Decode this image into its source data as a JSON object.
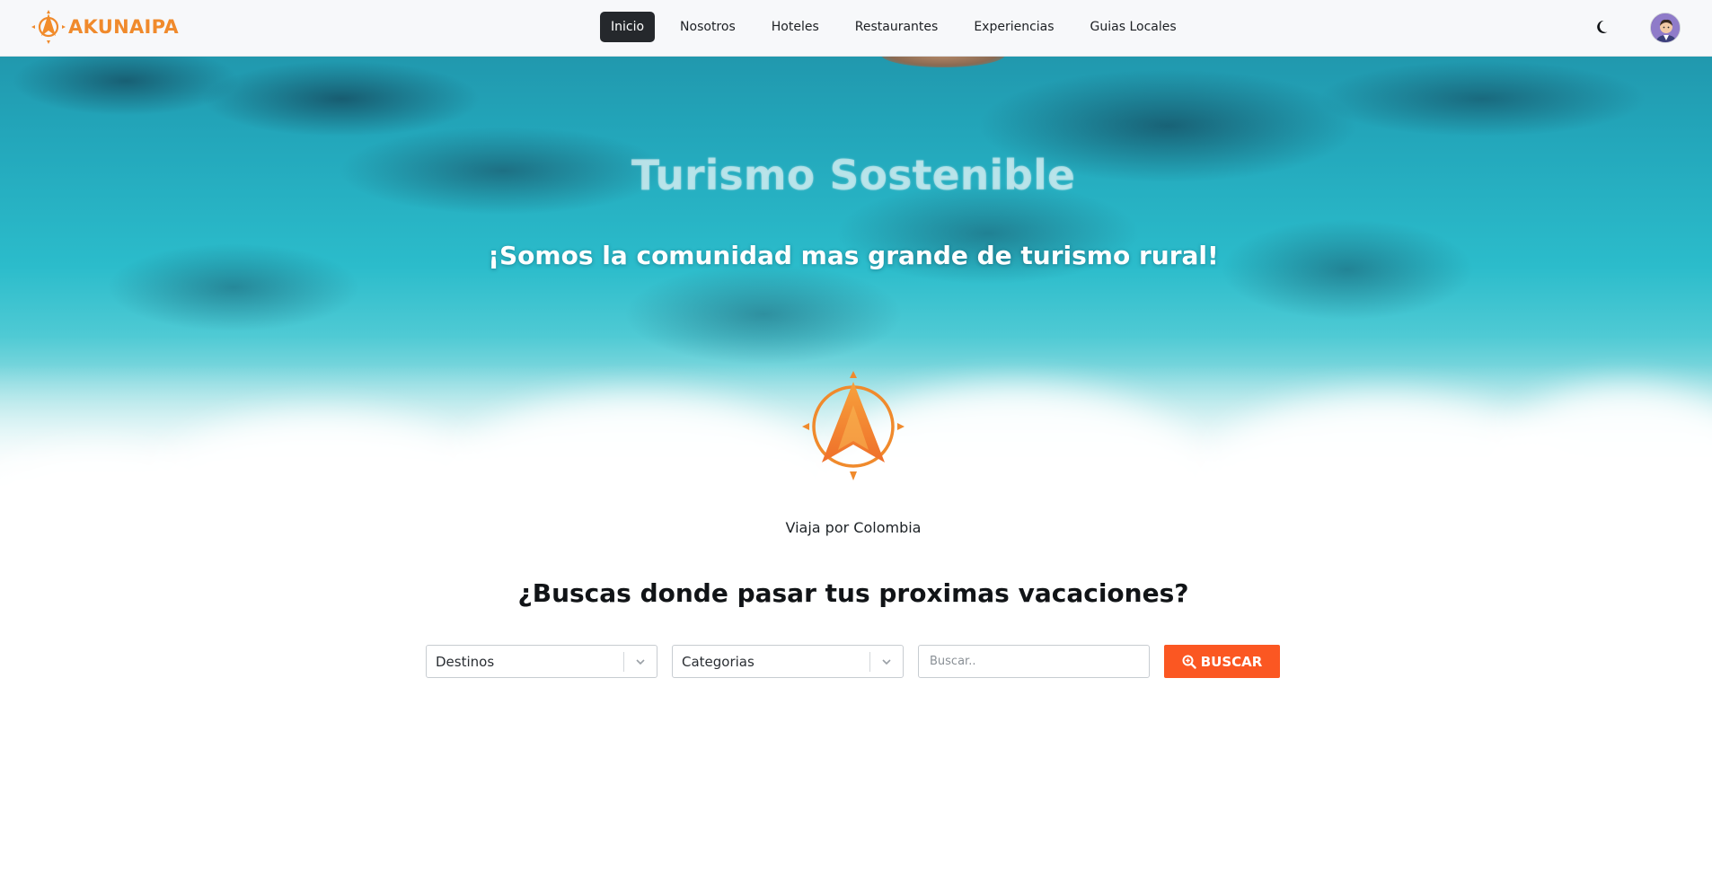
{
  "brand": {
    "name": "AKUNAIPA",
    "accent": "#f08a2c"
  },
  "nav": {
    "items": [
      {
        "label": "Inicio",
        "active": true
      },
      {
        "label": "Nosotros",
        "active": false
      },
      {
        "label": "Hoteles",
        "active": false
      },
      {
        "label": "Restaurantes",
        "active": false
      },
      {
        "label": "Experiencias",
        "active": false
      },
      {
        "label": "Guias Locales",
        "active": false
      }
    ],
    "theme_toggle_icon": "moon-icon",
    "avatar_icon": "user-avatar-icon"
  },
  "hero": {
    "title": "Turismo Sostenible",
    "subtitle": "¡Somos la comunidad mas grande de turismo rural!",
    "emblem_icon": "compass-logo-icon",
    "caption": "Viaja por Colombia",
    "question": "¿Buscas donde pasar tus proximas vacaciones?"
  },
  "search": {
    "destinations_label": "Destinos",
    "categories_label": "Categorias",
    "input_placeholder": "Buscar..",
    "input_value": "",
    "button_label": "BUSCAR",
    "button_icon": "zoom-search-icon",
    "button_color": "#fb5722"
  }
}
